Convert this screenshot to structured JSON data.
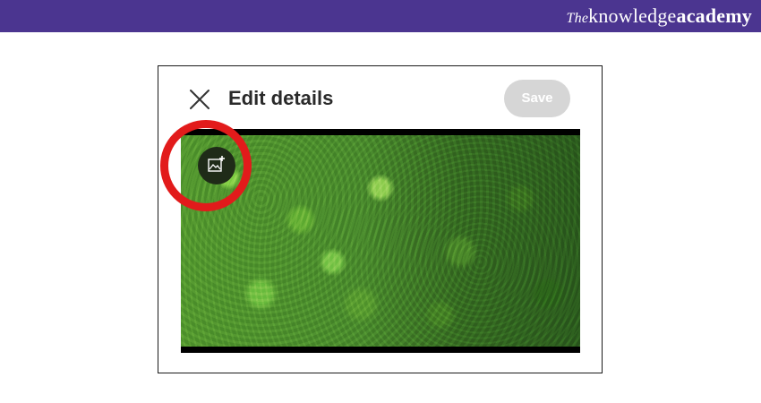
{
  "banner": {
    "brand_prefix": "The",
    "brand_middle": "knowledge",
    "brand_suffix": "academy",
    "color": "#4b3590"
  },
  "dialog": {
    "title": "Edit details",
    "save_label": "Save",
    "save_button_state": "disabled",
    "close_icon": "close-icon",
    "add_image_icon": "add-image-icon"
  },
  "media": {
    "image_subject": "aerial forest canopy"
  },
  "annotation": {
    "highlight_color": "#e21b1b"
  }
}
